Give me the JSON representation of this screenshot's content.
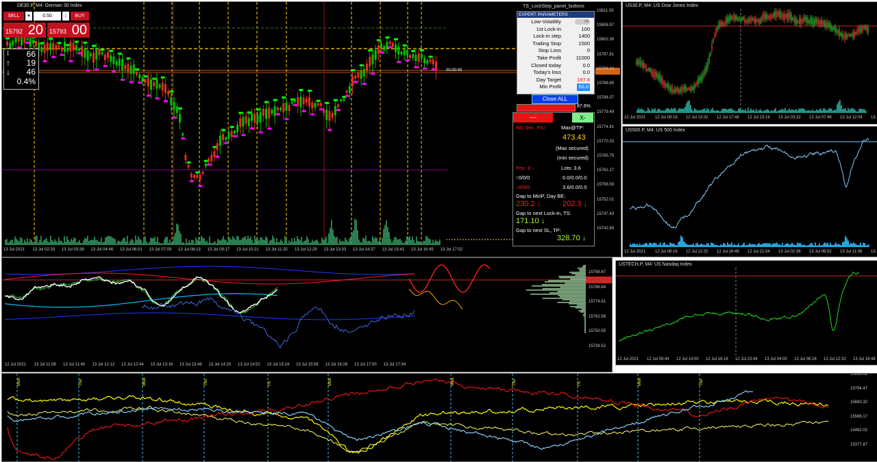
{
  "main_chart": {
    "symbol_title": ".DE30.P, M4: German 30 Index",
    "panel_name": "TS_LockStep_panel_buttons",
    "timer": "00:00:45",
    "trade": {
      "sell_label": "SELL",
      "buy_label": "BUY",
      "lot": "0.50",
      "bid_small": "15792",
      "bid_large": "20",
      "ask_small": "15793",
      "ask_large": "00"
    },
    "stats": {
      "v1": "66",
      "v2": "19",
      "v3": "46",
      "pct": "0.4%"
    },
    "price_axis": [
      "15811.55",
      "15806.97",
      "15802.39",
      "15797.81",
      "15793.23",
      "15788.65",
      "15784.07",
      "15779.49",
      "15774.91",
      "15770.33",
      "15765.75",
      "15761.17",
      "15756.59",
      "15752.01",
      "15747.43",
      "15742.85"
    ],
    "price_tags": [
      "15793.35",
      "15792.20"
    ],
    "time_axis": [
      "13 Jul 2021",
      "13 Jul 02:33",
      "13 Jul 03:38",
      "13 Jul 04:46",
      "13 Jul 06:01",
      "13 Jul 07:09",
      "13 Jul 08:13",
      "13 Jul 09:17",
      "13 Jul 10:21",
      "13 Jul 11:25",
      "13 Jul 12:29",
      "13 Jul 13:33",
      "13 Jul 14:37",
      "13 Jul 15:41",
      "13 Jul 16:45",
      "13 Jul 17:52"
    ]
  },
  "expert": {
    "header": "EXPERT PARAMETERS",
    "toggle": "Off",
    "rows": [
      {
        "k": "Low-Volatility",
        "v": ""
      },
      {
        "k": "1st Lock-in",
        "v": "100"
      },
      {
        "k": "Lock-in step",
        "v": "1400"
      },
      {
        "k": "Trailing Stop",
        "v": "1500"
      },
      {
        "k": "Stop Loss",
        "v": "0"
      },
      {
        "k": "Take Profit",
        "v": "11000"
      },
      {
        "k": "Closed today",
        "v": "0.0"
      },
      {
        "k": "Today's loss",
        "v": "0.0"
      },
      {
        "k": "Day Target",
        "v": "197.8"
      },
      {
        "k": "Min Profit",
        "v": "50.0"
      }
    ],
    "close_all": "Close ALL",
    "pct": "87.6%"
  },
  "info": {
    "red_btn": "----",
    "x_val": "X-↓-728.3",
    "no_sec": "NO Sec. P/L!",
    "max_tp": "Max@TP:",
    "val1": "473.43",
    "max_secured": "(Max secured)",
    "min_secured": "(min secured)",
    "pos": "Pos: 8 ↓",
    "lots": "Lots: 3.6",
    "r1a": "↑0/0/0",
    "r1b": "0.0/0.0/0.0",
    "r2a": "↓8/0/0",
    "r2b": "3.6/0.0/0.0",
    "gap1": "Gap to MinP, Day BE:",
    "gap1a": "230.2 ↓",
    "gap1b": "202.3 ↓",
    "gap2": "Gap to next Lock-in, TS:",
    "gap2a": "171.10 ↓",
    "gap3": "Gap to next SL, TP:",
    "gap3a": "328.70 ↓"
  },
  "dow": {
    "title": "US30.P, M4: US Dow Jones Index",
    "time_axis": [
      "12 Jul 2021",
      "12 Jul 09:16",
      "12 Jul 13:32",
      "12 Jul 17:48",
      "12 Jul 23:16",
      "13 Jul 03:32",
      "13 Jul 07:48",
      "13 Jul 12:04",
      "13 Jul 16:20"
    ]
  },
  "sp": {
    "title": "US500.P, M4: US 500 Index",
    "time_axis": [
      "12 Jul 2021",
      "12 Jul 08:16",
      "12 Jul 12:32",
      "12 Jul 16:48",
      "12 Jul 21:04",
      "13 Jul 02:36",
      "13 Jul 06:52",
      "13 Jul 11:08",
      "13 Jul 15:24"
    ]
  },
  "nasdaq": {
    "title": "USTECH.P, M4: US Nasdaq Index",
    "time_axis": [
      "12 Jul 2021",
      "12 Jul 09:44",
      "12 Jul 14:00",
      "12 Jul 18:16",
      "12 Jul 23:44",
      "13 Jul 04:00",
      "13 Jul 08:16",
      "13 Jul 12:32",
      "13 Jul 16:48"
    ]
  },
  "mid": {
    "price_axis": [
      "15798.67",
      "15786.64",
      "15774.61",
      "15762.58",
      "15750.55",
      "15738.52"
    ],
    "price_tag": "15793.20",
    "time_axis": [
      "12 Jul 2021",
      "13 Jul 11:08",
      "13 Jul 11:40",
      "13 Jul 12:12",
      "13 Jul 12:44",
      "13 Jul 13:16",
      "13 Jul 13:48",
      "13 Jul 14:20",
      "13 Jul 14:52",
      "13 Jul 15:24",
      "13 Jul 15:56",
      "13 Jul 16:28",
      "13 Jul 17:00",
      "13 Jul 17:34"
    ]
  },
  "bottom": {
    "price_axis": [
      "15898.62",
      "15794.47",
      "15690.32",
      "15586.17",
      "15482.02",
      "15377.87"
    ],
    "days": [
      "Mon",
      "Tue",
      "Wed",
      "Thu",
      "Fri",
      "Mon",
      "Wed",
      "Thu",
      "Fri",
      "Mon",
      "Tue"
    ]
  },
  "colors": {
    "bg": "#000000",
    "up": "#00e000",
    "down": "#ff2020",
    "yellow_line": "#ffff00",
    "cyan": "#87cefa",
    "purple": "#8b008b"
  }
}
